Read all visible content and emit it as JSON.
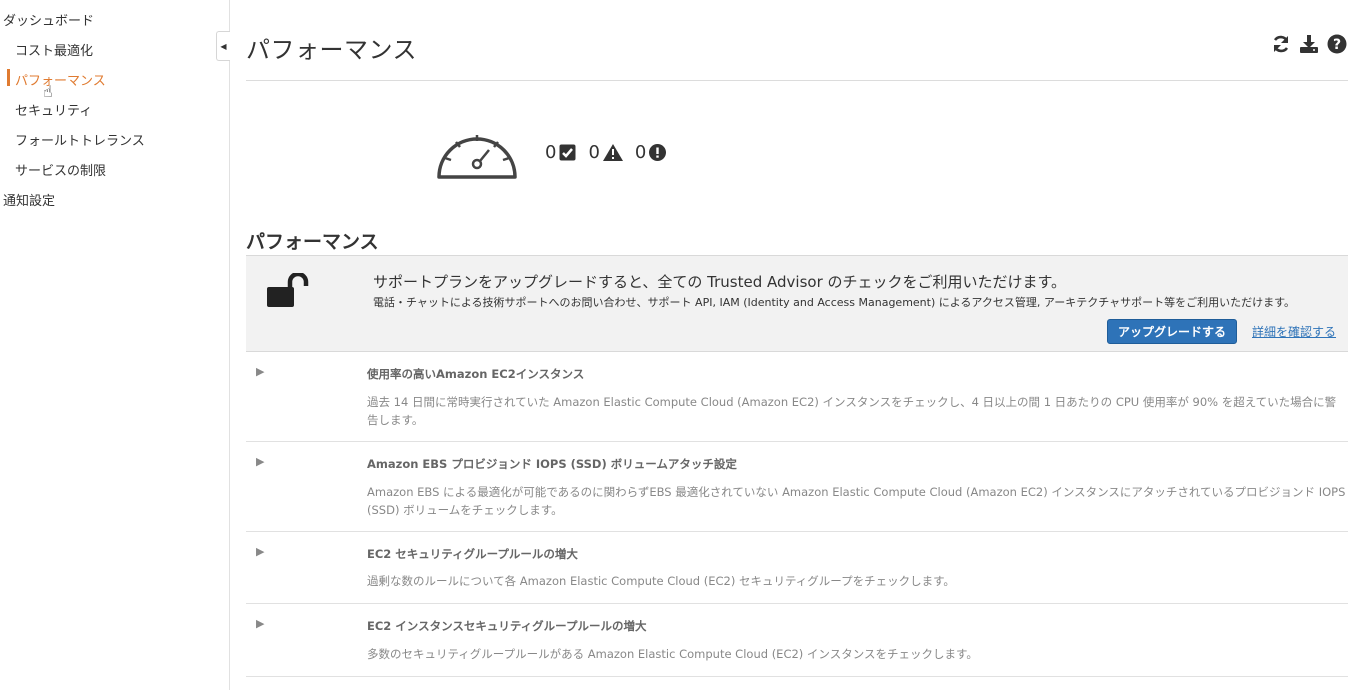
{
  "sidebar": {
    "items": [
      {
        "label": "ダッシュボード"
      },
      {
        "label": "コスト最適化"
      },
      {
        "label": "パフォーマンス"
      },
      {
        "label": "セキュリティ"
      },
      {
        "label": "フォールトトレランス"
      },
      {
        "label": "サービスの制限"
      },
      {
        "label": "通知設定"
      }
    ],
    "active_color": "#e07b31"
  },
  "header": {
    "title": "パフォーマンス",
    "icons": [
      "refresh-icon",
      "download-icon",
      "help-icon"
    ]
  },
  "summary": {
    "ok_count": "0",
    "warning_count": "0",
    "error_count": "0"
  },
  "section": {
    "title": "パフォーマンス"
  },
  "banner": {
    "title": "サポートプランをアップグレードすると、全ての Trusted Advisor のチェックをご利用いただけます。",
    "description": "電話・チャットによる技術サポートへのお問い合わせ、サポート API, IAM (Identity and Access Management) によるアクセス管理, アーキテクチャサポート等をご利用いただけます。",
    "upgrade_button": "アップグレードする",
    "details_link": "詳細を確認する",
    "button_color": "#2e73b8"
  },
  "checks": [
    {
      "title": "使用率の高いAmazon EC2インスタンス",
      "description": "過去 14 日間に常時実行されていた Amazon Elastic Compute Cloud (Amazon EC2) インスタンスをチェックし、4 日以上の間 1 日あたりの CPU 使用率が 90% を超えていた場合に警告します。"
    },
    {
      "title": "Amazon EBS プロビジョンド IOPS (SSD) ボリュームアタッチ設定",
      "description": "Amazon EBS による最適化が可能であるのに関わらずEBS 最適化されていない Amazon Elastic Compute Cloud (Amazon EC2) インスタンスにアタッチされているプロビジョンド IOPS (SSD) ボリュームをチェックします。"
    },
    {
      "title": "EC2 セキュリティグループルールの増大",
      "description": "過剰な数のルールについて各 Amazon Elastic Compute Cloud (EC2) セキュリティグループをチェックします。"
    },
    {
      "title": "EC2 インスタンスセキュリティグループルールの増大",
      "description": "多数のセキュリティグループルールがある Amazon Elastic Compute Cloud (EC2) インスタンスをチェックします。"
    }
  ]
}
